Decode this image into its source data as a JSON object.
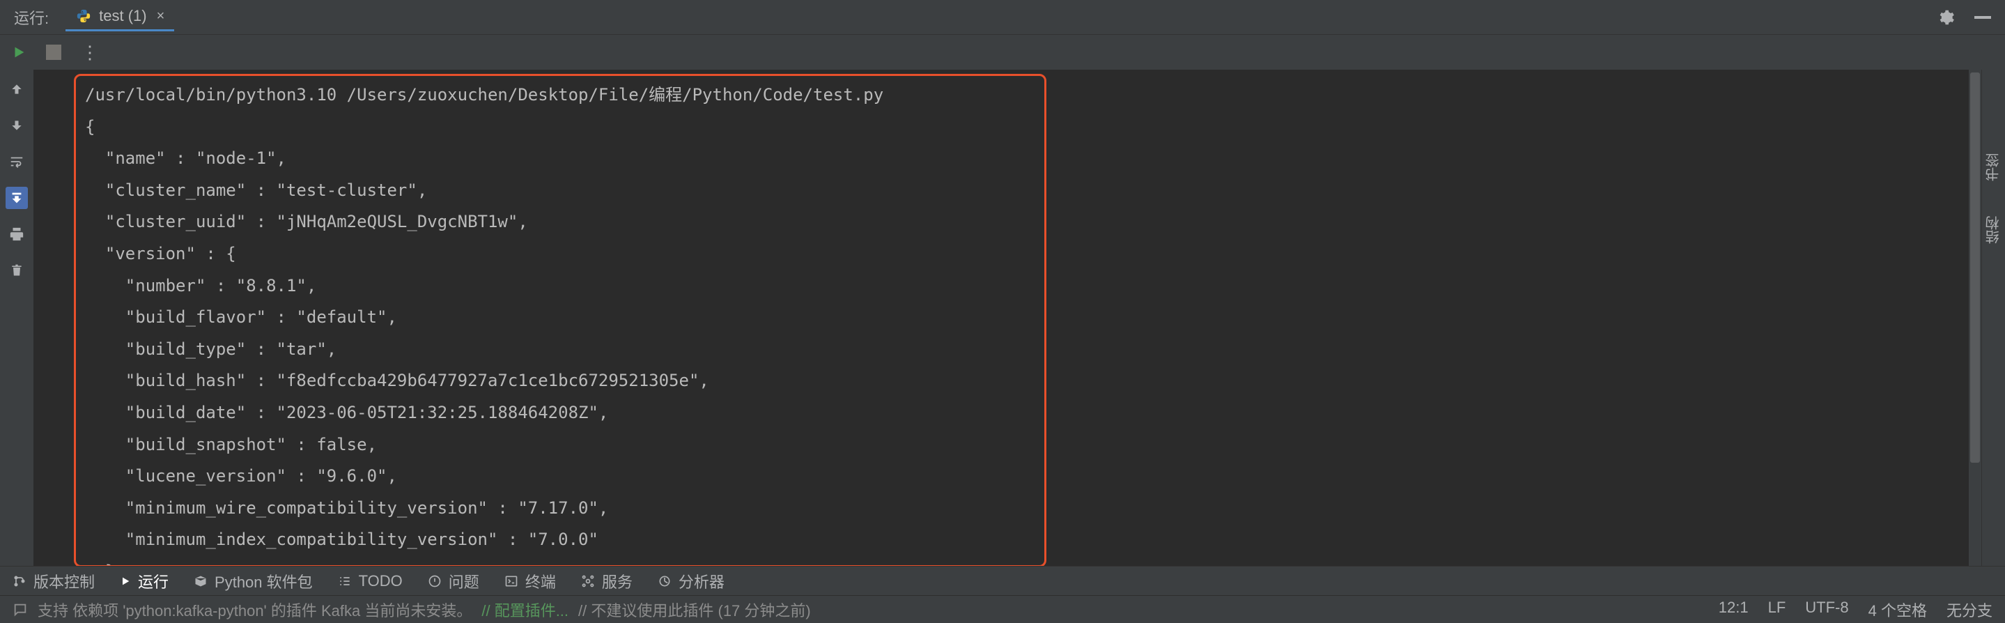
{
  "topbar": {
    "run_label": "运行:",
    "tab_title": "test (1)",
    "tab_close": "×"
  },
  "console": {
    "lines": [
      "/usr/local/bin/python3.10 /Users/zuoxuchen/Desktop/File/编程/Python/Code/test.py",
      "{",
      "  \"name\" : \"node-1\",",
      "  \"cluster_name\" : \"test-cluster\",",
      "  \"cluster_uuid\" : \"jNHqAm2eQUSL_DvgcNBT1w\",",
      "  \"version\" : {",
      "    \"number\" : \"8.8.1\",",
      "    \"build_flavor\" : \"default\",",
      "    \"build_type\" : \"tar\",",
      "    \"build_hash\" : \"f8edfccba429b6477927a7c1ce1bc6729521305e\",",
      "    \"build_date\" : \"2023-06-05T21:32:25.188464208Z\",",
      "    \"build_snapshot\" : false,",
      "    \"lucene_version\" : \"9.6.0\",",
      "    \"minimum_wire_compatibility_version\" : \"7.17.0\",",
      "    \"minimum_index_compatibility_version\" : \"7.0.0\"",
      "  },"
    ]
  },
  "right": {
    "bookmarks": "书签",
    "structure": "结构"
  },
  "toolbar": {
    "vcs": "版本控制",
    "run": "运行",
    "packages": "Python 软件包",
    "todo": "TODO",
    "problems": "问题",
    "terminal": "终端",
    "services": "服务",
    "profiler": "分析器"
  },
  "status": {
    "msg_1": "支持 依赖项 'python:kafka-python' 的插件 Kafka 当前尚未安装。",
    "msg_2": "// 配置插件...",
    "msg_3": "// 不建议使用此插件 (17 分钟之前)",
    "pos": "12:1",
    "lf": "LF",
    "enc": "UTF-8",
    "spaces": "4 个空格",
    "branch": "无分支"
  }
}
